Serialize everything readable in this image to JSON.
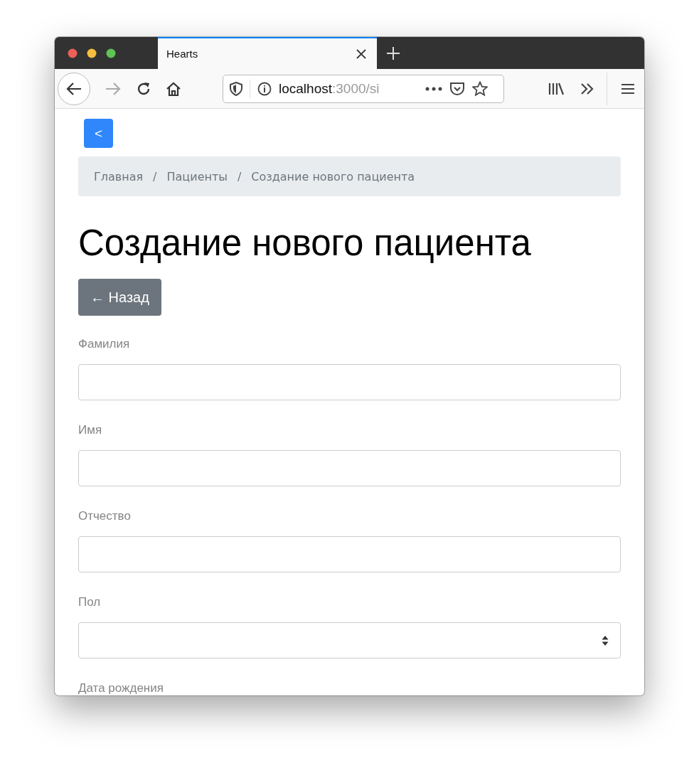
{
  "browser": {
    "tab": {
      "title": "Hearts",
      "selected": true
    },
    "address": {
      "host": "localhost",
      "rest": ":3000/si"
    }
  },
  "page": {
    "nav_button": "<",
    "breadcrumb": [
      {
        "label": "Главная",
        "separator": "/"
      },
      {
        "label": "Пациенты",
        "separator": "/"
      },
      {
        "label": "Создание нового пациента"
      }
    ],
    "title": "Создание нового пациента",
    "back_button": "← Назад",
    "fields": [
      {
        "label": "Фамилия",
        "kind": "text"
      },
      {
        "label": "Имя",
        "kind": "text"
      },
      {
        "label": "Отчество",
        "kind": "text"
      },
      {
        "label": "Пол",
        "kind": "select"
      },
      {
        "label": "Дата рождения",
        "kind": "label"
      }
    ]
  }
}
